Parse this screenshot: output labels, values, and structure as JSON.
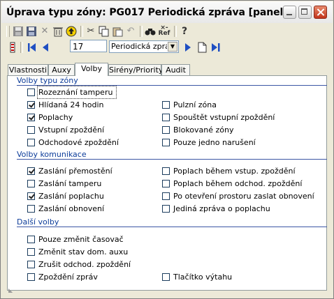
{
  "window": {
    "title": "Úprava typu zóny: PG017 Periodická zpráva [panel]"
  },
  "toolbar": {
    "record_number": "17",
    "record_select": "Periodická zpráv"
  },
  "tabs": [
    {
      "label": "Vlastnosti"
    },
    {
      "label": "Auxy"
    },
    {
      "label": "Volby"
    },
    {
      "label": "Sirény/Priority"
    },
    {
      "label": "Audit"
    }
  ],
  "sections": {
    "zone": "Volby typu zóny",
    "comm": "Volby komunikace",
    "other": "Další volby"
  },
  "zone_left": [
    {
      "label": "Rozeznání tamperu",
      "checked": false
    },
    {
      "label": "Hlídaná 24 hodin",
      "checked": true
    },
    {
      "label": "Poplachy",
      "checked": true
    },
    {
      "label": "Vstupní zpoždění",
      "checked": false
    },
    {
      "label": "Odchodové zpoždění",
      "checked": false
    }
  ],
  "zone_right": [
    {
      "label": "Pulzní zóna",
      "checked": false
    },
    {
      "label": "Spouštět vstupní zpoždění",
      "checked": false
    },
    {
      "label": "Blokované zóny",
      "checked": false
    },
    {
      "label": "Pouze jedno narušení",
      "checked": false
    }
  ],
  "comm_left": [
    {
      "label": "Zaslání přemostění",
      "checked": true
    },
    {
      "label": "Zaslání tamperu",
      "checked": false
    },
    {
      "label": "Zaslání poplachu",
      "checked": true
    },
    {
      "label": "Zaslání obnovení",
      "checked": false
    }
  ],
  "comm_right": [
    {
      "label": "Poplach během vstup. zpoždění",
      "checked": false
    },
    {
      "label": "Poplach během odchod. zpoždění",
      "checked": false
    },
    {
      "label": "Po otevření prostoru zaslat obnovení",
      "checked": false
    },
    {
      "label": "Jediná zpráva o poplachu",
      "checked": false
    }
  ],
  "other_left": [
    {
      "label": "Pouze změnit časovač",
      "checked": false
    },
    {
      "label": "Změnit stav dom. auxu",
      "checked": false
    },
    {
      "label": "Zrušit odchod. zpoždění",
      "checked": false
    },
    {
      "label": "Zpoždění zpráv",
      "checked": false
    }
  ],
  "other_right": [
    {
      "label": "Tlačítko výtahu",
      "checked": false
    }
  ]
}
